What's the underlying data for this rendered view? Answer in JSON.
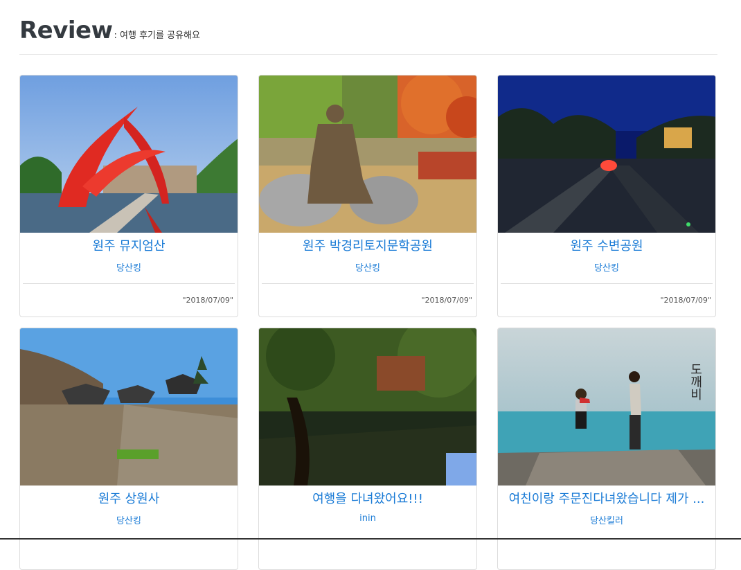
{
  "header": {
    "title": "Review",
    "subtitle": ": 여행 후기를 공유해요"
  },
  "cards": [
    {
      "title": "원주 뮤지엄산",
      "author": "당산킹",
      "date": "\"2018/07/09\""
    },
    {
      "title": "원주 박경리토지문학공원",
      "author": "당산킹",
      "date": "\"2018/07/09\""
    },
    {
      "title": "원주 수변공원",
      "author": "당산킹",
      "date": "\"2018/07/09\""
    },
    {
      "title": "원주 상원사",
      "author": "당산킹",
      "date": ""
    },
    {
      "title": "여행을 다녀왔어요!!!",
      "author": "inin",
      "date": ""
    },
    {
      "title": "여친이랑 주문진다녀왔습니다 제가 ...",
      "author": "당산킬러",
      "date": ""
    }
  ],
  "image_overlays": {
    "card6_logo_text": "도깨비"
  }
}
